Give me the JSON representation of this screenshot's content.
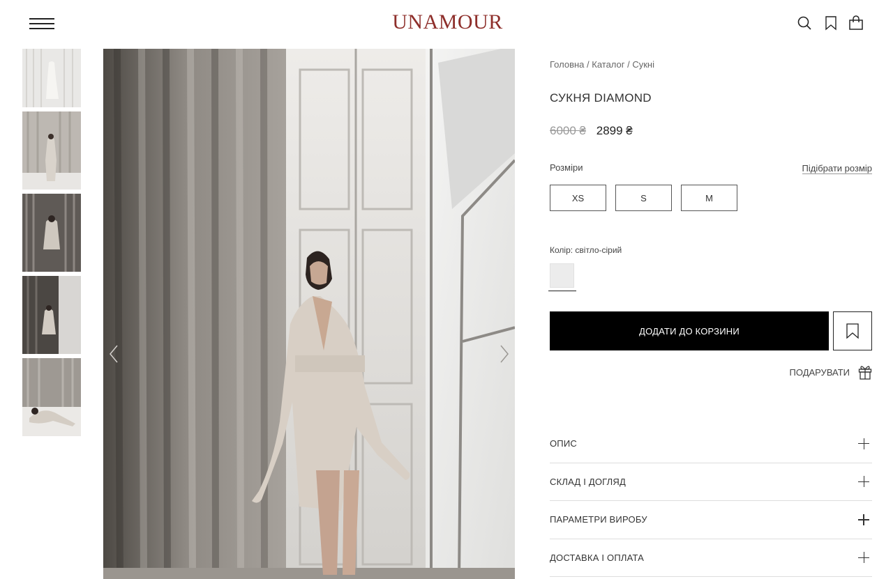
{
  "header": {
    "logo": "UNAMOUR",
    "menu_icon": "hamburger-menu-icon",
    "icons": [
      "search-icon",
      "bookmark-icon",
      "shopping-bag-icon"
    ]
  },
  "breadcrumb": {
    "items": [
      "Головна",
      "Каталог",
      "Сукні"
    ],
    "separator": " / "
  },
  "product": {
    "title": "СУКНЯ DIAMOND",
    "old_price": "6000 ₴",
    "price": "2899 ₴",
    "sizes_label": "Розміри",
    "size_guide": "Підібрати розмір",
    "sizes": [
      "XS",
      "S",
      "M"
    ],
    "color_label": "Колір: світло-сірий",
    "color_swatch": "#ececec",
    "add_to_cart": "ДОДАТИ ДО КОРЗИНИ",
    "gift_label": "ПОДАРУВАТИ"
  },
  "accordion": [
    "ОПИС",
    "СКЛАД І ДОГЛЯД",
    "ПАРАМЕТРИ ВИРОБУ",
    "ДОСТАВКА І ОПЛАТА"
  ],
  "gallery": {
    "thumbnail_count": 5,
    "prev_icon": "chevron-left-icon",
    "next_icon": "chevron-right-icon"
  },
  "colors": {
    "brand": "#8e2f2b",
    "button_bg": "#000000",
    "old_price": "#999999"
  }
}
